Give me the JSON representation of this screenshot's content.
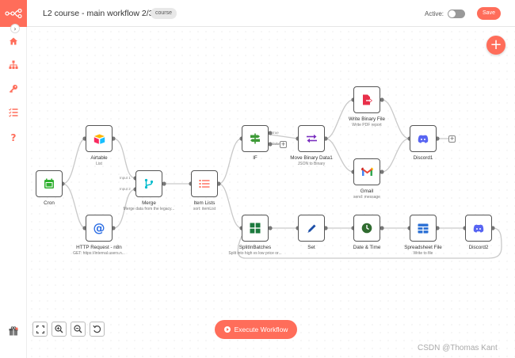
{
  "header": {
    "title": "L2 course - main workflow 2/3",
    "tag": "course",
    "active_label": "Active:",
    "active": false,
    "save_label": "Save"
  },
  "colors": {
    "accent": "#ff6d5a",
    "edge": "#c9c9c9",
    "port": "#777777"
  },
  "sidebar": {
    "items": [
      {
        "icon": "home-icon"
      },
      {
        "icon": "network-icon"
      },
      {
        "icon": "key-icon"
      },
      {
        "icon": "list-check-icon"
      },
      {
        "icon": "question-icon"
      },
      {
        "icon": "gift-icon"
      }
    ]
  },
  "nodes": {
    "cron": {
      "name": "Cron",
      "sub": ""
    },
    "airtable": {
      "name": "Airtable",
      "sub": "List"
    },
    "http": {
      "name": "HTTP Request - n8n",
      "sub": "GET: https://internal.users.n..."
    },
    "merge": {
      "name": "Merge",
      "sub": "Merge data from the legacy...",
      "input1": "Input 1",
      "input2": "Input 2"
    },
    "itemlists": {
      "name": "Item Lists",
      "sub": "sort: itemList"
    },
    "if": {
      "name": "IF",
      "sub": "",
      "true_label": "true",
      "false_label": "false"
    },
    "movebin": {
      "name": "Move Binary Data1",
      "sub": "JSON to Binary"
    },
    "writebin": {
      "name": "Write Binary File",
      "sub": "Write PDF report"
    },
    "gmail": {
      "name": "Gmail",
      "sub": "send: message"
    },
    "discord1": {
      "name": "Discord1",
      "sub": ""
    },
    "split": {
      "name": "SplitInBatches",
      "sub": "Split into high vs low price or..."
    },
    "set": {
      "name": "Set",
      "sub": ""
    },
    "datetime": {
      "name": "Date & Time",
      "sub": ""
    },
    "sheet": {
      "name": "Spreadsheet File",
      "sub": "Write to file"
    },
    "discord2": {
      "name": "Discord2",
      "sub": ""
    }
  },
  "controls": {
    "execute_label": "Execute Workflow",
    "zoom": [
      "fullscreen-icon",
      "zoom-in-icon",
      "zoom-out-icon",
      "reset-icon"
    ]
  },
  "watermark": "CSDN @Thomas Kant"
}
